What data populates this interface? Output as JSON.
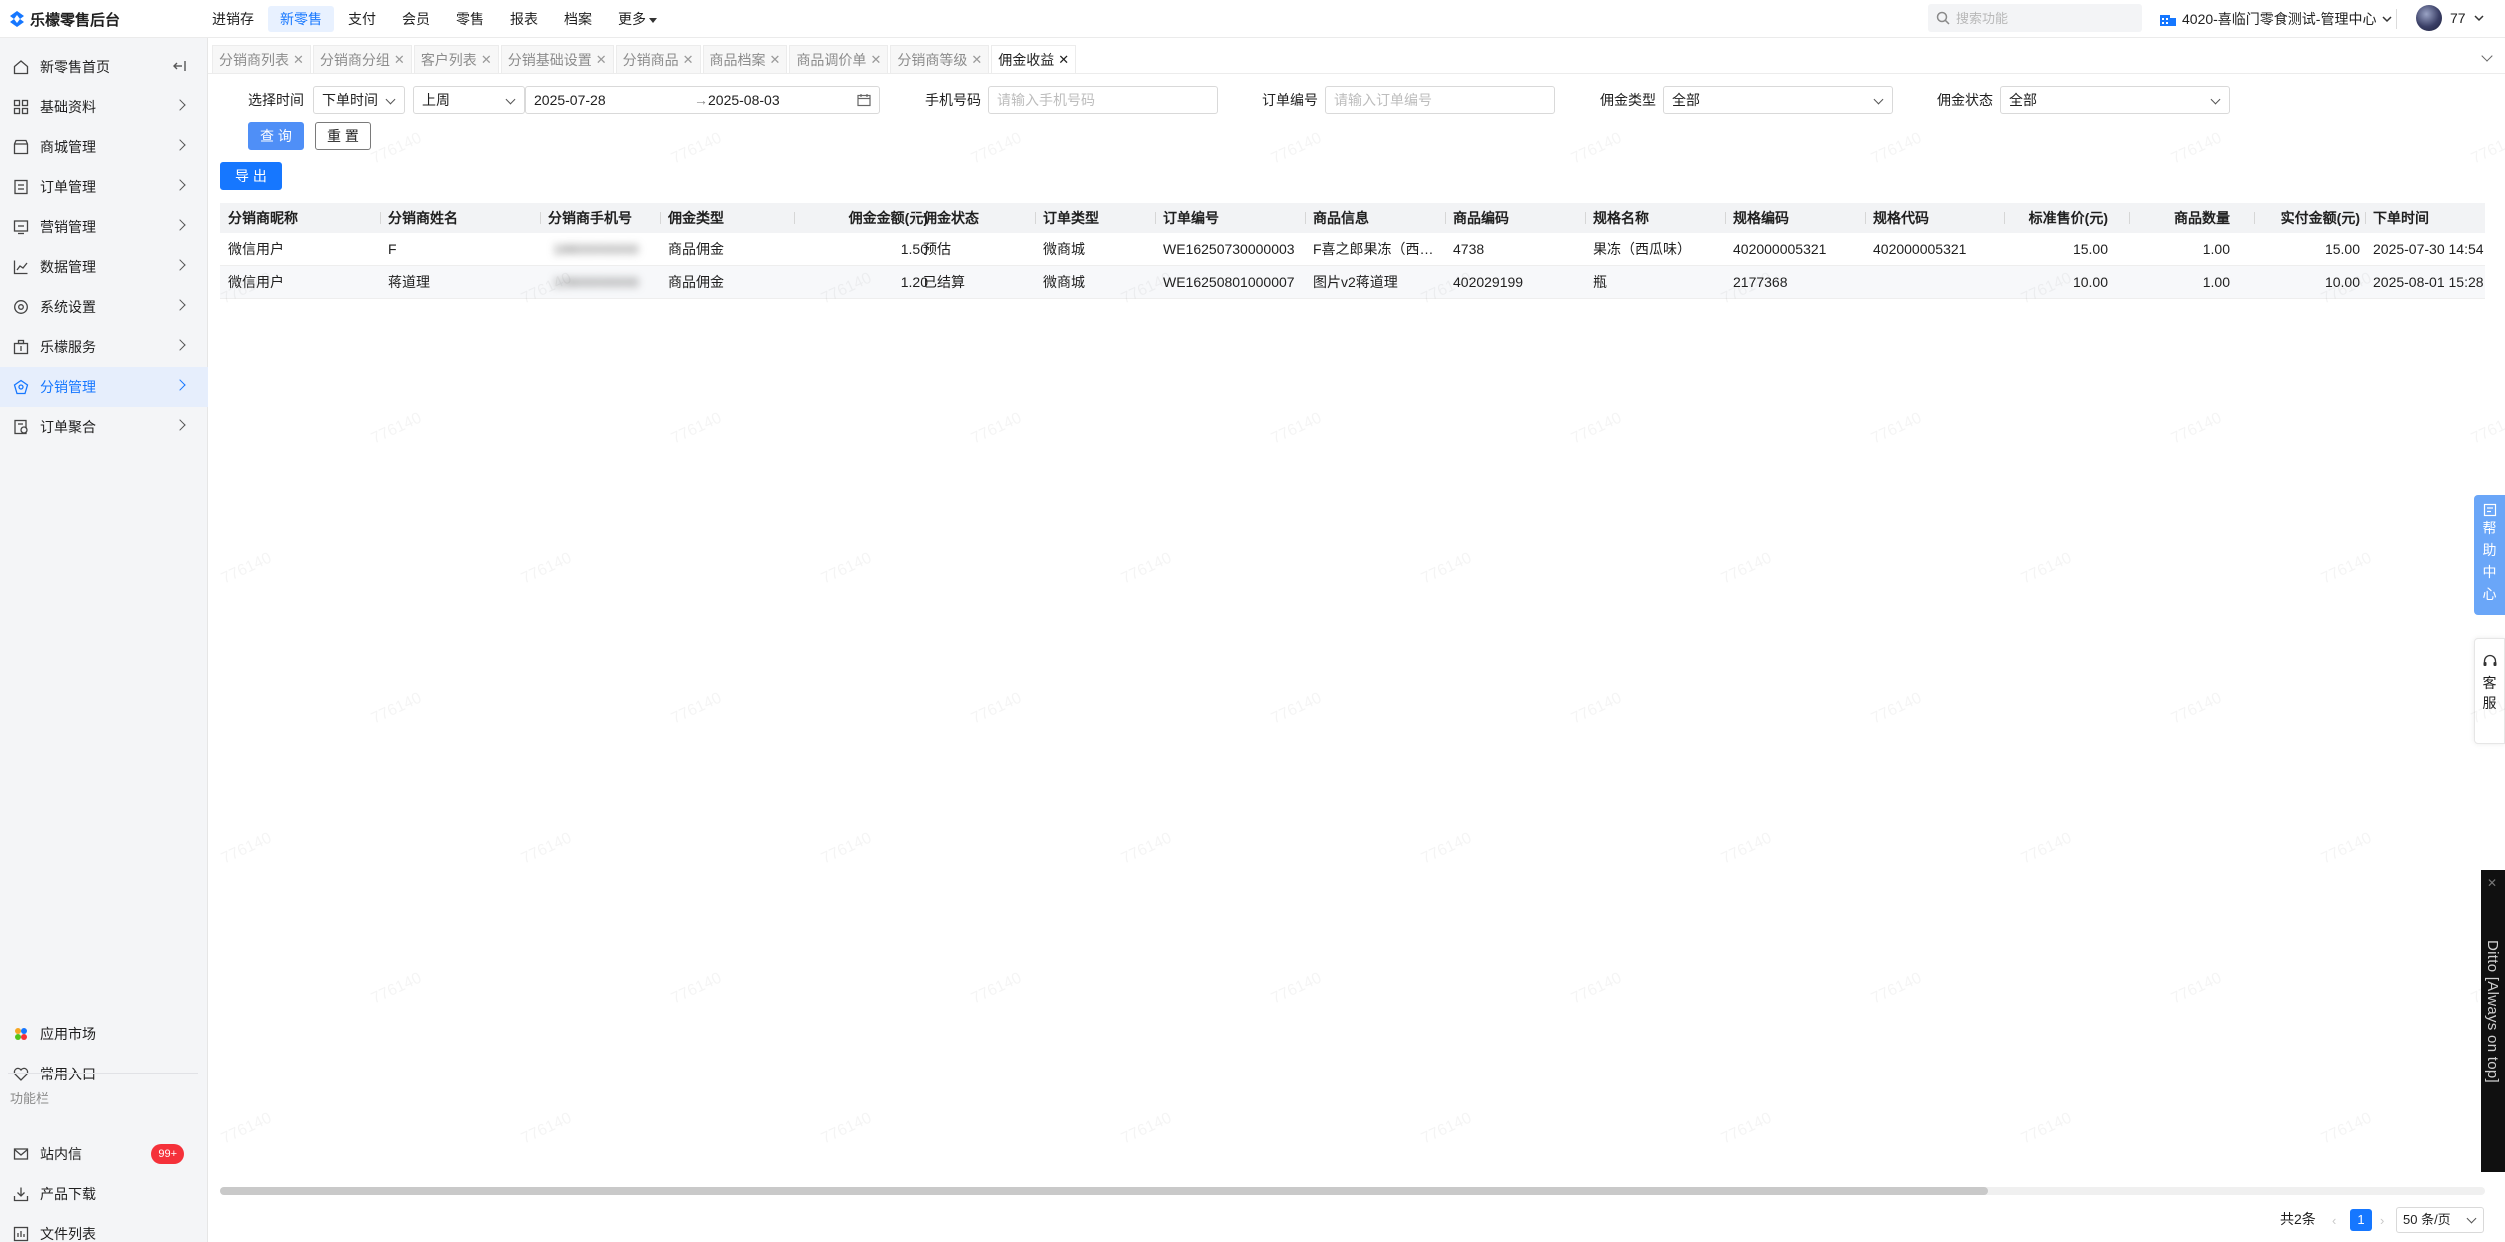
{
  "app": {
    "title": "乐檬零售后台"
  },
  "topnav": [
    "进销存",
    "新零售",
    "支付",
    "会员",
    "零售",
    "报表",
    "档案",
    "更多"
  ],
  "topnav_active": 1,
  "search": {
    "placeholder": "搜索功能"
  },
  "store": {
    "name": "4020-喜临门零食测试-管理中心"
  },
  "user": {
    "name": "77"
  },
  "sidebar": {
    "items": [
      {
        "label": "新零售首页",
        "icon": "home-icon"
      },
      {
        "label": "基础资料",
        "icon": "grid-icon"
      },
      {
        "label": "商城管理",
        "icon": "store-icon"
      },
      {
        "label": "订单管理",
        "icon": "order-icon"
      },
      {
        "label": "营销管理",
        "icon": "marketing-icon"
      },
      {
        "label": "数据管理",
        "icon": "chart-icon"
      },
      {
        "label": "系统设置",
        "icon": "settings-icon"
      },
      {
        "label": "乐檬服务",
        "icon": "briefcase-icon"
      },
      {
        "label": "分销管理",
        "icon": "distribution-icon"
      },
      {
        "label": "订单聚合",
        "icon": "aggregate-icon"
      }
    ],
    "active": 8,
    "bottom": {
      "app_market": "应用市场",
      "common_entry": "常用入口",
      "group_label": "功能栏",
      "inbox": "站内信",
      "inbox_badge": "99+",
      "download": "产品下载",
      "files": "文件列表"
    }
  },
  "tabs": [
    "分销商列表",
    "分销商分组",
    "客户列表",
    "分销基础设置",
    "分销商品",
    "商品档案",
    "商品调价单",
    "分销商等级",
    "佣金收益"
  ],
  "active_tab": 8,
  "filters": {
    "time_label": "选择时间",
    "time_type": "下单时间",
    "period": "上周",
    "date_start": "2025-07-28",
    "date_sep": "→",
    "date_end": "2025-08-03",
    "phone_label": "手机号码",
    "phone_placeholder": "请输入手机号码",
    "order_label": "订单编号",
    "order_placeholder": "请输入订单编号",
    "commission_type_label": "佣金类型",
    "commission_type": "全部",
    "commission_status_label": "佣金状态",
    "commission_status": "全部",
    "query": "查 询",
    "reset": "重 置",
    "export": "导 出"
  },
  "table": {
    "columns": [
      "分销商昵称",
      "分销商姓名",
      "分销商手机号",
      "佣金类型",
      "佣金金额(元)",
      "佣金状态",
      "订单类型",
      "订单编号",
      "商品信息",
      "商品编码",
      "规格名称",
      "规格编码",
      "规格代码",
      "标准售价(元)",
      "商品数量",
      "实付金额(元)",
      "下单时间"
    ],
    "rows": [
      [
        "微信用户",
        "F",
        "18800000000",
        "商品佣金",
        "1.50",
        "预估",
        "微商城",
        "WE16250730000003",
        "F喜之郎果冻（西…",
        "4738",
        "果冻（西瓜味）",
        "402000005321",
        "402000005321",
        "15.00",
        "1.00",
        "15.00",
        "2025-07-30 14:54"
      ],
      [
        "微信用户",
        "蒋道理",
        "13900000000",
        "商品佣金",
        "1.20",
        "已结算",
        "微商城",
        "WE16250801000007",
        "图片v2蒋道理",
        "402029199",
        "瓶",
        "2177368",
        "",
        "10.00",
        "1.00",
        "10.00",
        "2025-08-01 15:28"
      ]
    ]
  },
  "pagination": {
    "total": "共2条",
    "current": "1",
    "page_size": "50 条/页"
  },
  "floaters": {
    "help": [
      "帮",
      "助",
      "中",
      "心"
    ],
    "service": [
      "客",
      "服"
    ]
  },
  "ditto": "Ditto [Always on top]",
  "watermark": "776140",
  "colors": {
    "accent": "#1677ff",
    "badge": "#f5313a"
  }
}
